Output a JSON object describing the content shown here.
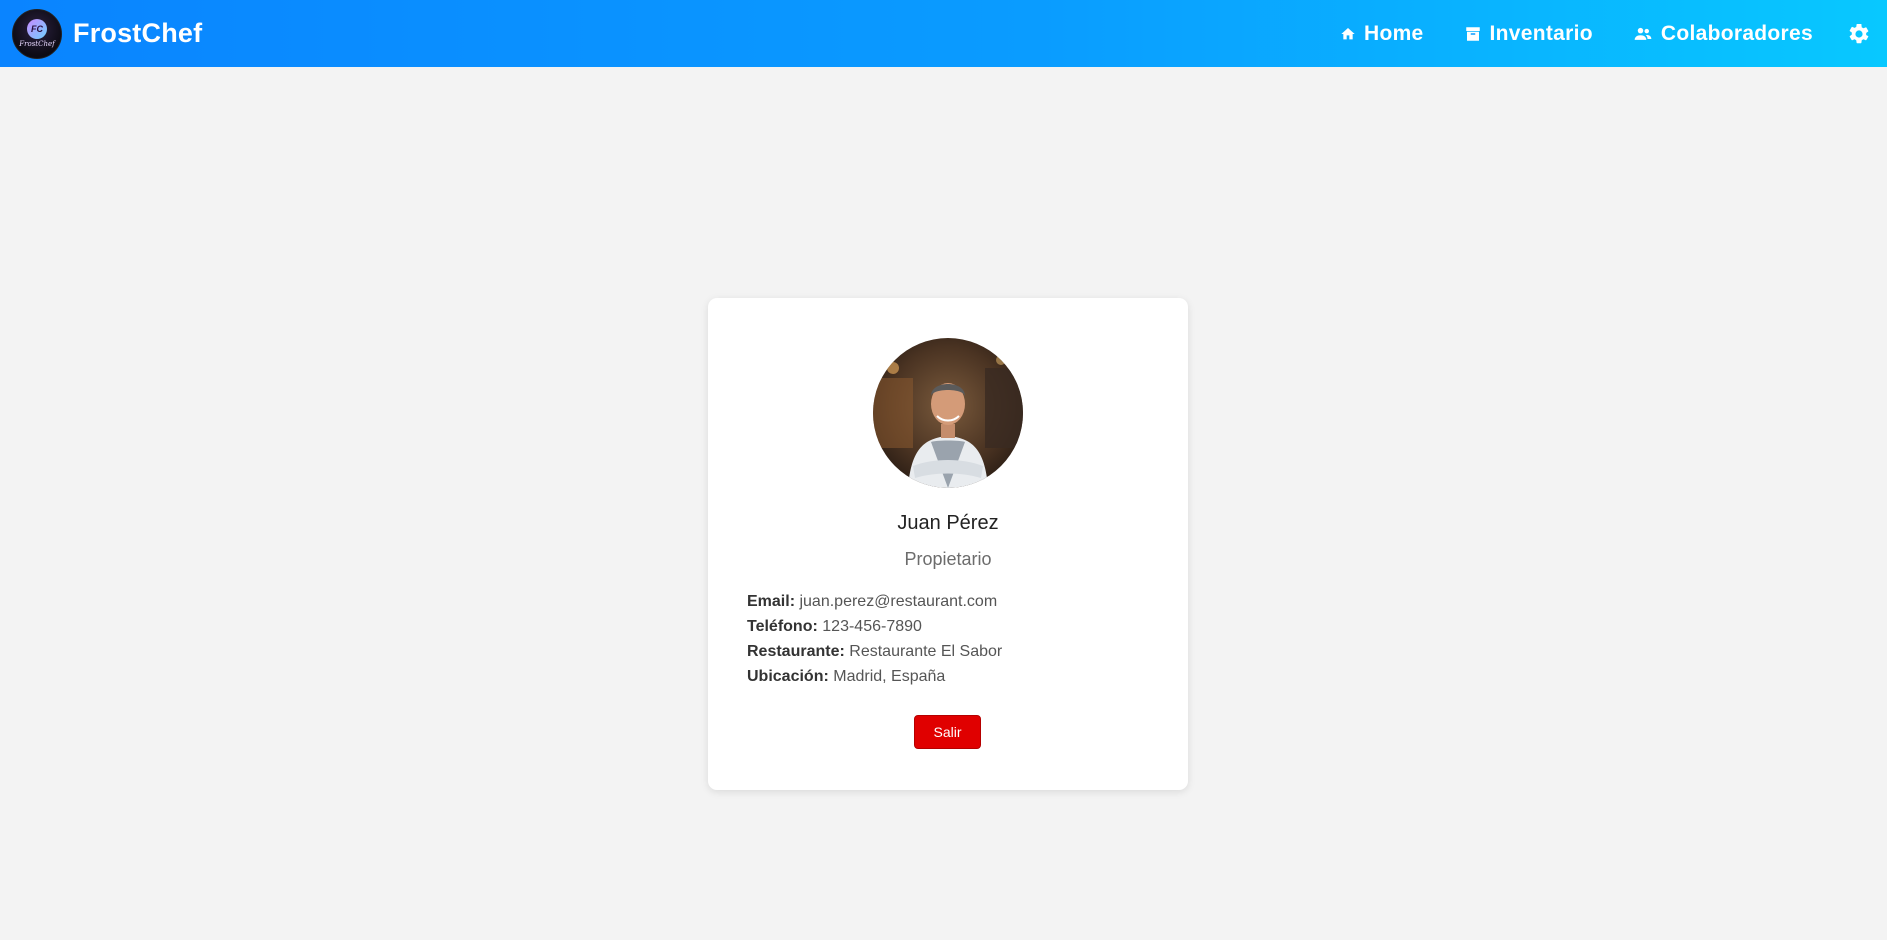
{
  "navbar": {
    "brand_name": "FrostChef",
    "logo_text": "FrostChef",
    "logo_initials": "FC",
    "links": [
      {
        "label": "Home",
        "icon": "home-icon"
      },
      {
        "label": "Inventario",
        "icon": "archive-icon"
      },
      {
        "label": "Colaboradores",
        "icon": "people-icon"
      }
    ],
    "settings_icon": "gear-icon"
  },
  "profile": {
    "name": "Juan Pérez",
    "role": "Propietario",
    "avatar_icon": "chef-avatar",
    "fields": [
      {
        "label": "Email:",
        "value": "juan.perez@restaurant.com"
      },
      {
        "label": "Teléfono:",
        "value": "123-456-7890"
      },
      {
        "label": "Restaurante:",
        "value": "Restaurante El Sabor"
      },
      {
        "label": "Ubicación:",
        "value": "Madrid, España"
      }
    ],
    "logout_label": "Salir"
  },
  "colors": {
    "navbar_gradient_start": "#0a84ff",
    "navbar_gradient_end": "#08c8ff",
    "logout_button": "#e00000",
    "page_background": "#f3f3f3"
  }
}
